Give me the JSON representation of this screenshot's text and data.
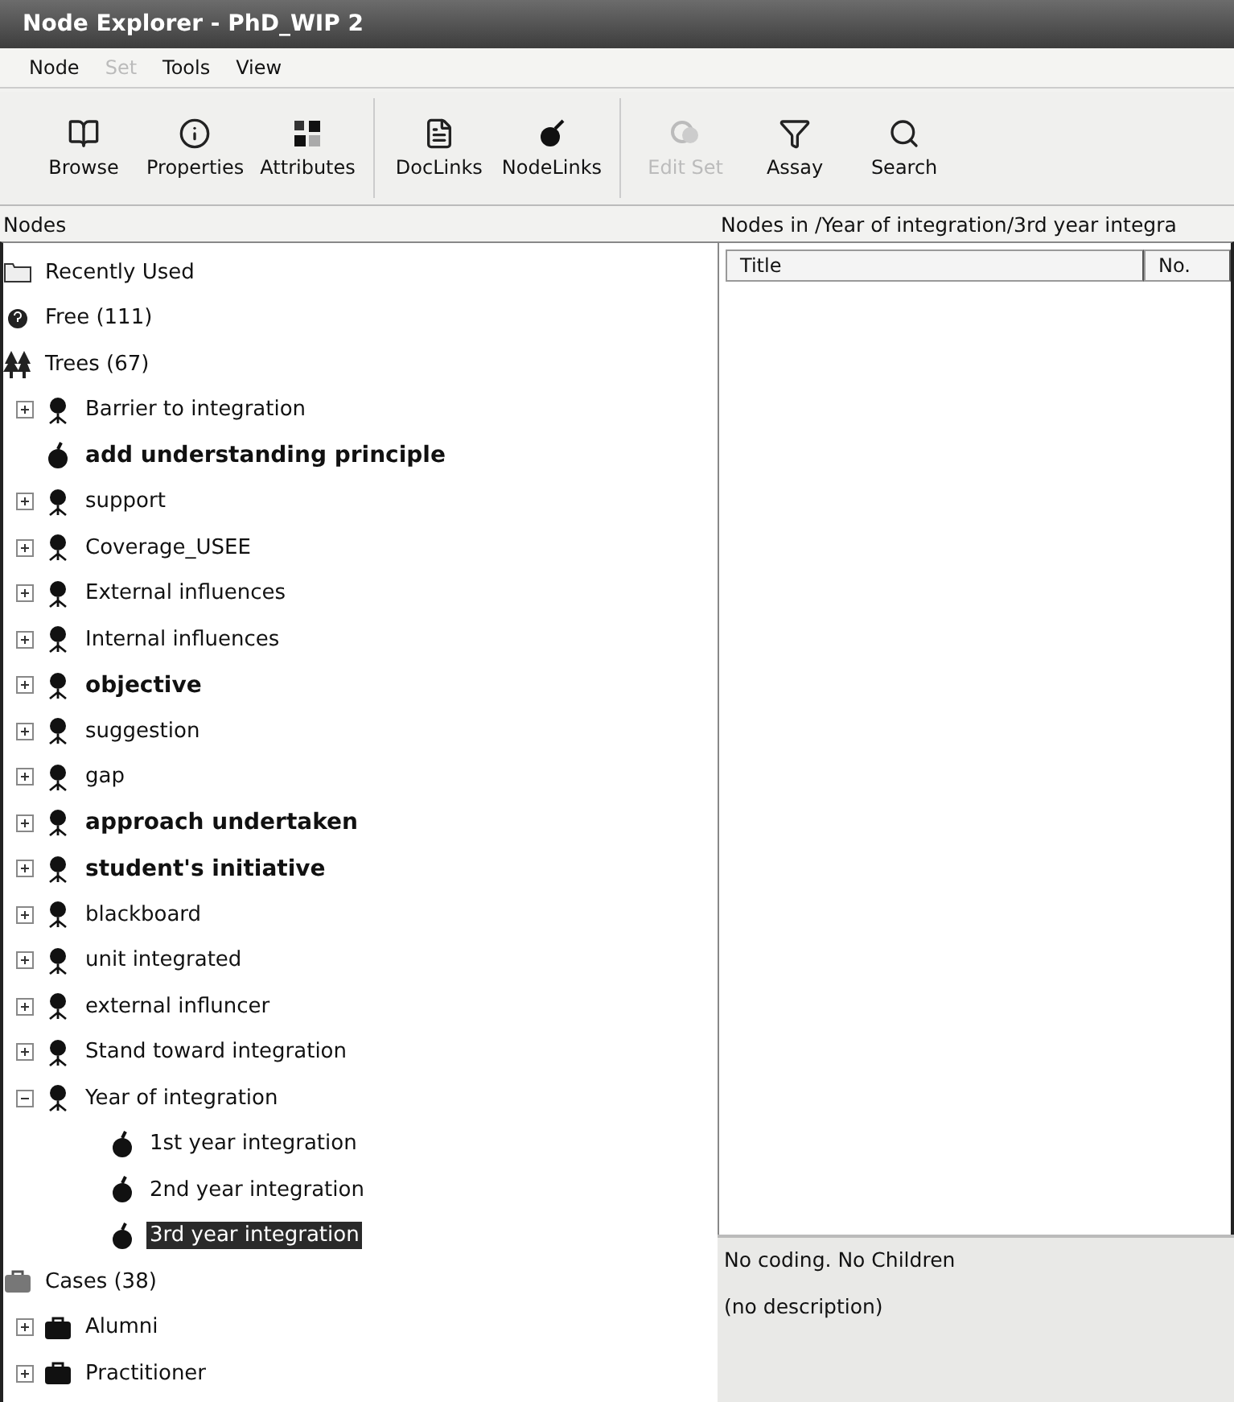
{
  "window": {
    "title": "Node Explorer - PhD_WIP 2"
  },
  "menu": [
    {
      "label": "Node",
      "disabled": false
    },
    {
      "label": "Set",
      "disabled": true
    },
    {
      "label": "Tools",
      "disabled": false
    },
    {
      "label": "View",
      "disabled": false
    }
  ],
  "toolbar": [
    [
      {
        "label": "Browse",
        "kind": "book",
        "disabled": false
      },
      {
        "label": "Properties",
        "kind": "info",
        "disabled": false
      },
      {
        "label": "Attributes",
        "kind": "squares",
        "disabled": false
      }
    ],
    [
      {
        "label": "DocLinks",
        "kind": "document",
        "disabled": false
      },
      {
        "label": "NodeLinks",
        "kind": "ball",
        "disabled": false
      }
    ],
    [
      {
        "label": "Edit Set",
        "kind": "circles",
        "disabled": true
      },
      {
        "label": "Assay",
        "kind": "filter",
        "disabled": false
      },
      {
        "label": "Search",
        "kind": "search",
        "disabled": false
      }
    ]
  ],
  "nodes_pane": {
    "title": "Nodes"
  },
  "tree": [
    {
      "label": "Recently Used",
      "kind": "recent",
      "bold": false,
      "selected": false
    },
    {
      "label": "Free (111)",
      "kind": "free",
      "bold": false,
      "selected": false
    },
    {
      "label": "Trees (67)",
      "kind": "trees",
      "bold": false,
      "selected": false,
      "children": [
        {
          "label": "Barrier to integration",
          "kind": "node",
          "bold": false,
          "selected": false,
          "expanded": false
        },
        {
          "label": "add understanding principle",
          "kind": "leaf",
          "bold": true,
          "selected": false
        },
        {
          "label": "support",
          "kind": "node",
          "bold": false,
          "selected": false,
          "expanded": false
        },
        {
          "label": "Coverage_USEE",
          "kind": "node",
          "bold": false,
          "selected": false,
          "expanded": false
        },
        {
          "label": "External influences",
          "kind": "node",
          "bold": false,
          "selected": false,
          "expanded": false
        },
        {
          "label": "Internal influences",
          "kind": "node",
          "bold": false,
          "selected": false,
          "expanded": false
        },
        {
          "label": "objective",
          "kind": "node",
          "bold": true,
          "selected": false,
          "expanded": false
        },
        {
          "label": "suggestion",
          "kind": "node",
          "bold": false,
          "selected": false,
          "expanded": false
        },
        {
          "label": "gap",
          "kind": "node",
          "bold": false,
          "selected": false,
          "expanded": false
        },
        {
          "label": "approach undertaken",
          "kind": "node",
          "bold": true,
          "selected": false,
          "expanded": false
        },
        {
          "label": "student's initiative",
          "kind": "node",
          "bold": true,
          "selected": false,
          "expanded": false
        },
        {
          "label": "blackboard",
          "kind": "node",
          "bold": false,
          "selected": false,
          "expanded": false
        },
        {
          "label": "unit integrated",
          "kind": "node",
          "bold": false,
          "selected": false,
          "expanded": false
        },
        {
          "label": "external influncer",
          "kind": "node",
          "bold": false,
          "selected": false,
          "expanded": false
        },
        {
          "label": "Stand toward integration",
          "kind": "node",
          "bold": false,
          "selected": false,
          "expanded": false
        },
        {
          "label": "Year of integration",
          "kind": "node",
          "bold": false,
          "selected": false,
          "expanded": true,
          "children": [
            {
              "label": "1st year integration",
              "kind": "leaf",
              "bold": false,
              "selected": false
            },
            {
              "label": "2nd year integration",
              "kind": "leaf",
              "bold": false,
              "selected": false
            },
            {
              "label": "3rd year integration",
              "kind": "leaf",
              "bold": false,
              "selected": true
            }
          ]
        }
      ]
    },
    {
      "label": "Cases (38)",
      "kind": "cases",
      "bold": false,
      "selected": false,
      "children": [
        {
          "label": "Alumni",
          "kind": "case",
          "bold": false,
          "selected": false,
          "expanded": false
        },
        {
          "label": "Practitioner",
          "kind": "case",
          "bold": false,
          "selected": false,
          "expanded": false
        }
      ]
    }
  ],
  "list_pane": {
    "title": "Nodes in /Year of integration/3rd year integra",
    "columns": [
      "Title",
      "No."
    ]
  },
  "details": {
    "status": "No coding. No Children",
    "description": "(no description)"
  }
}
